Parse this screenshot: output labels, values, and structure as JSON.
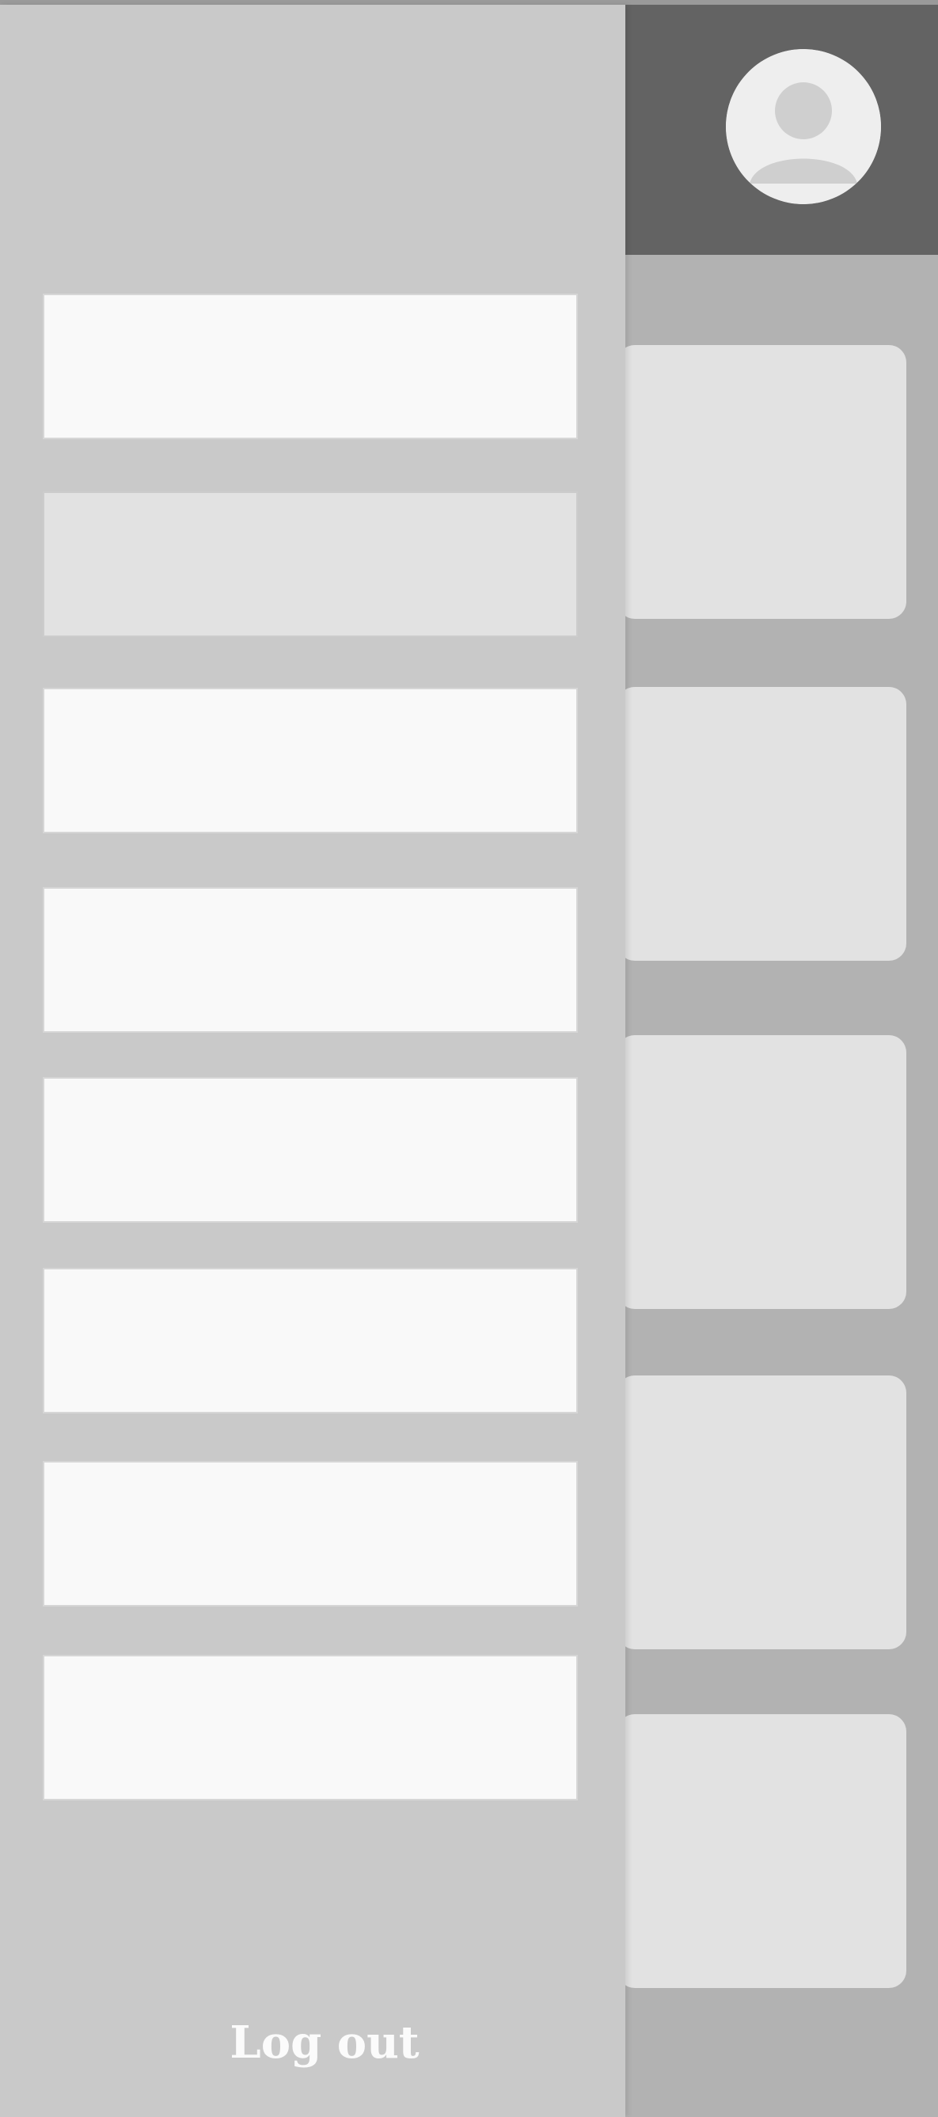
{
  "drawer": {
    "title": "",
    "subtitle": "",
    "menu_items": [
      {
        "label": "",
        "active": false
      },
      {
        "label": "",
        "active": true
      },
      {
        "label": "",
        "active": false
      },
      {
        "label": "",
        "active": false
      },
      {
        "label": "",
        "active": false
      },
      {
        "label": "",
        "active": false
      },
      {
        "label": "",
        "active": false
      },
      {
        "label": "",
        "active": false
      }
    ],
    "logout_label": "Log out"
  },
  "header": {
    "avatar_icon": "user-avatar-icon"
  },
  "content": {
    "cards": [
      "",
      "",
      "",
      "",
      ""
    ]
  },
  "colors": {
    "drawer_bg": "#c9c9c9",
    "menu_item_bg": "#f9f9f9",
    "menu_item_active_bg": "#e2e2e2",
    "header_bg": "#636363",
    "page_bg": "#b2b2b2",
    "card_bg": "#e2e2e2",
    "logout_text": "#fbfbfb"
  }
}
